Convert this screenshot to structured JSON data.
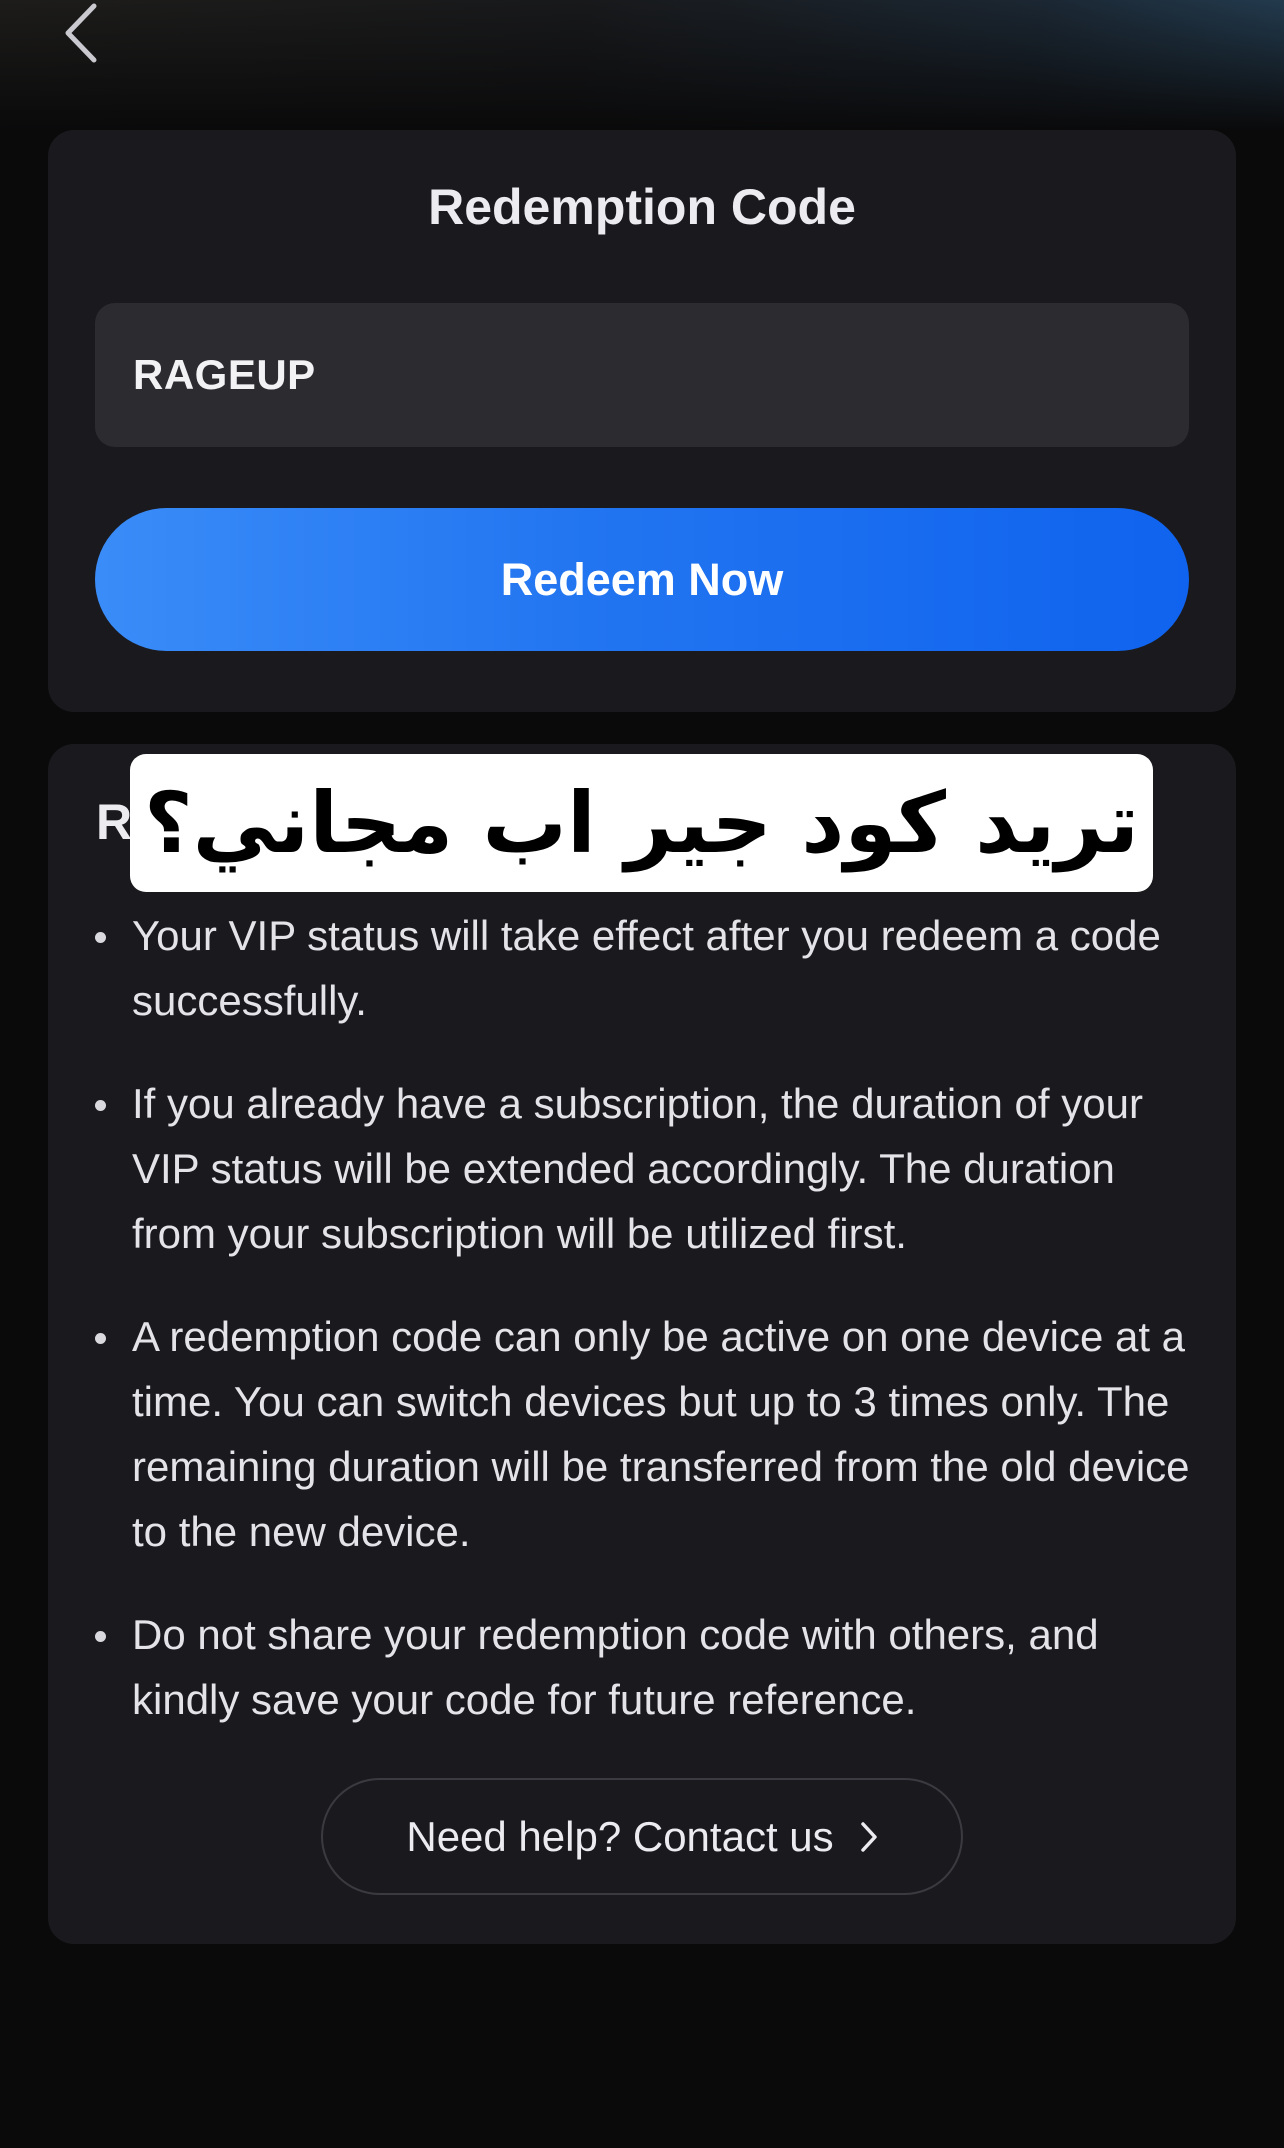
{
  "header": {
    "back_icon": "chevron-left-icon"
  },
  "redeem_card": {
    "title": "Redemption Code",
    "code_value": "RAGEUP",
    "redeem_button_label": "Redeem Now",
    "button_color": "#1f72f0"
  },
  "rules_card": {
    "title_peek": "R",
    "overlay_text": "تريد كود جير اب مجاني؟",
    "rules": [
      "Your VIP status will take effect after you redeem a code successfully.",
      "If you already have a subscription, the duration of your VIP status will be extended accordingly. The duration from your subscription will be utilized first.",
      "A redemption code can only be active on one device at a time. You can switch devices but up to 3 times only. The remaining duration will be transferred from the old device to the new device.",
      "Do not share your redemption code with others, and kindly save your code for future reference."
    ],
    "help_button_label": "Need help? Contact us",
    "help_icon": "chevron-right-icon"
  }
}
